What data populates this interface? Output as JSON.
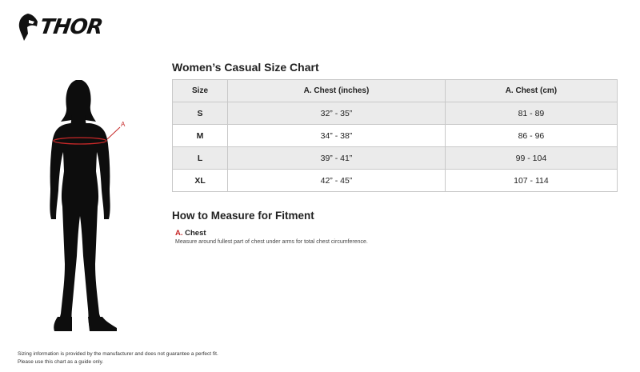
{
  "brand": {
    "name": "THOR",
    "icon": "thor-helmet-logo-icon"
  },
  "chart": {
    "title": "Women’s Casual Size Chart",
    "columns": [
      "Size",
      "A. Chest (inches)",
      "A. Chest (cm)"
    ],
    "rows": [
      {
        "size": "S",
        "chest_in": "32” - 35”",
        "chest_cm": "81 - 89"
      },
      {
        "size": "M",
        "chest_in": "34” - 38”",
        "chest_cm": "86 - 96"
      },
      {
        "size": "L",
        "chest_in": "39” - 41”",
        "chest_cm": "99 - 104"
      },
      {
        "size": "XL",
        "chest_in": "42” - 45”",
        "chest_cm": "107 - 114"
      }
    ]
  },
  "figure": {
    "marker_label": "A",
    "marker_color": "#c62828"
  },
  "measure": {
    "title": "How to Measure for Fitment",
    "items": [
      {
        "letter": "A.",
        "label": "Chest",
        "description": "Measure around fullest part of chest under arms for total chest circumference."
      }
    ]
  },
  "footnote": {
    "line1": "Sizing information is provided by the manufacturer and does not guarantee a perfect fit.",
    "line2": "Please use this chart as a guide only."
  }
}
